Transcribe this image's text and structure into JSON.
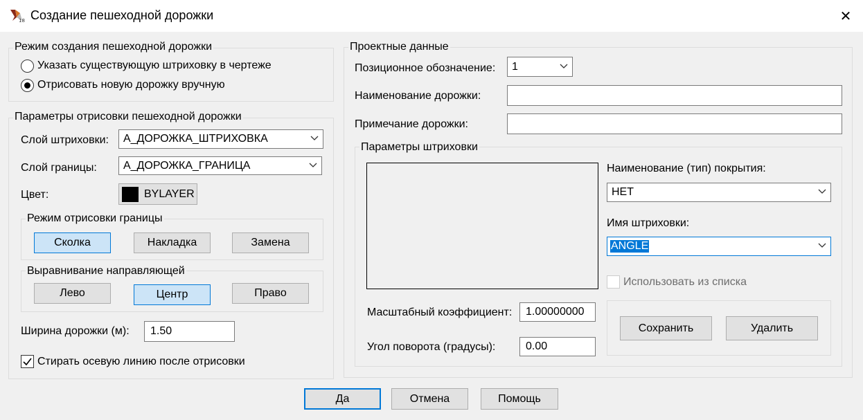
{
  "window": {
    "title": "Создание пешеходной дорожки",
    "close_glyph": "✕"
  },
  "mode": {
    "title": "Режим создания пешеходной  дорожки",
    "options": [
      {
        "label": "Указать существующую штриховку в чертеже",
        "selected": false
      },
      {
        "label": "Отрисовать новую дорожку вручную",
        "selected": true
      }
    ]
  },
  "draw_params": {
    "title": "Параметры отрисовки пешеходной дорожки",
    "hatch_layer_label": "Слой штриховки:",
    "hatch_layer_value": "А_ДОРОЖКА_ШТРИХОВКА",
    "border_layer_label": "Слой границы:",
    "border_layer_value": "А_ДОРОЖКА_ГРАНИЦА",
    "color_label": "Цвет:",
    "color_value": "BYLAYER",
    "color_swatch": "#000000",
    "border_mode": {
      "title": "Режим отрисовки границы",
      "buttons": [
        {
          "label": "Сколка",
          "active": true
        },
        {
          "label": "Накладка",
          "active": false
        },
        {
          "label": "Замена",
          "active": false
        }
      ]
    },
    "alignment": {
      "title": "Выравнивание направляющей",
      "buttons": [
        {
          "label": "Лево",
          "active": false
        },
        {
          "label": "Центр",
          "active": true
        },
        {
          "label": "Право",
          "active": false
        }
      ]
    },
    "width_label": "Ширина дорожки (м):",
    "width_value": "1.50",
    "erase_label": "Стирать осевую линию после отрисовки",
    "erase_checked": true
  },
  "project": {
    "title": "Проектные данные",
    "position_label": "Позиционное обозначение:",
    "position_value": "1",
    "name_label": "Наименование дорожки:",
    "name_value": "",
    "note_label": "Примечание дорожки:",
    "note_value": "",
    "hatch": {
      "title": "Параметры штриховки",
      "coating_label": "Наименование (тип) покрытия:",
      "coating_value": "НЕТ",
      "hatch_name_label": "Имя штриховки:",
      "hatch_name_value": "ANGLE",
      "use_list_label": "Использовать из списка",
      "use_list_checked": false,
      "scale_label": "Масштабный коэффициент:",
      "scale_value": "1.00000000",
      "angle_label": "Угол поворота (градусы):",
      "angle_value": "0.00",
      "save_label": "Сохранить",
      "delete_label": "Удалить"
    }
  },
  "footer": {
    "ok": "Да",
    "cancel": "Отмена",
    "help": "Помощь"
  }
}
